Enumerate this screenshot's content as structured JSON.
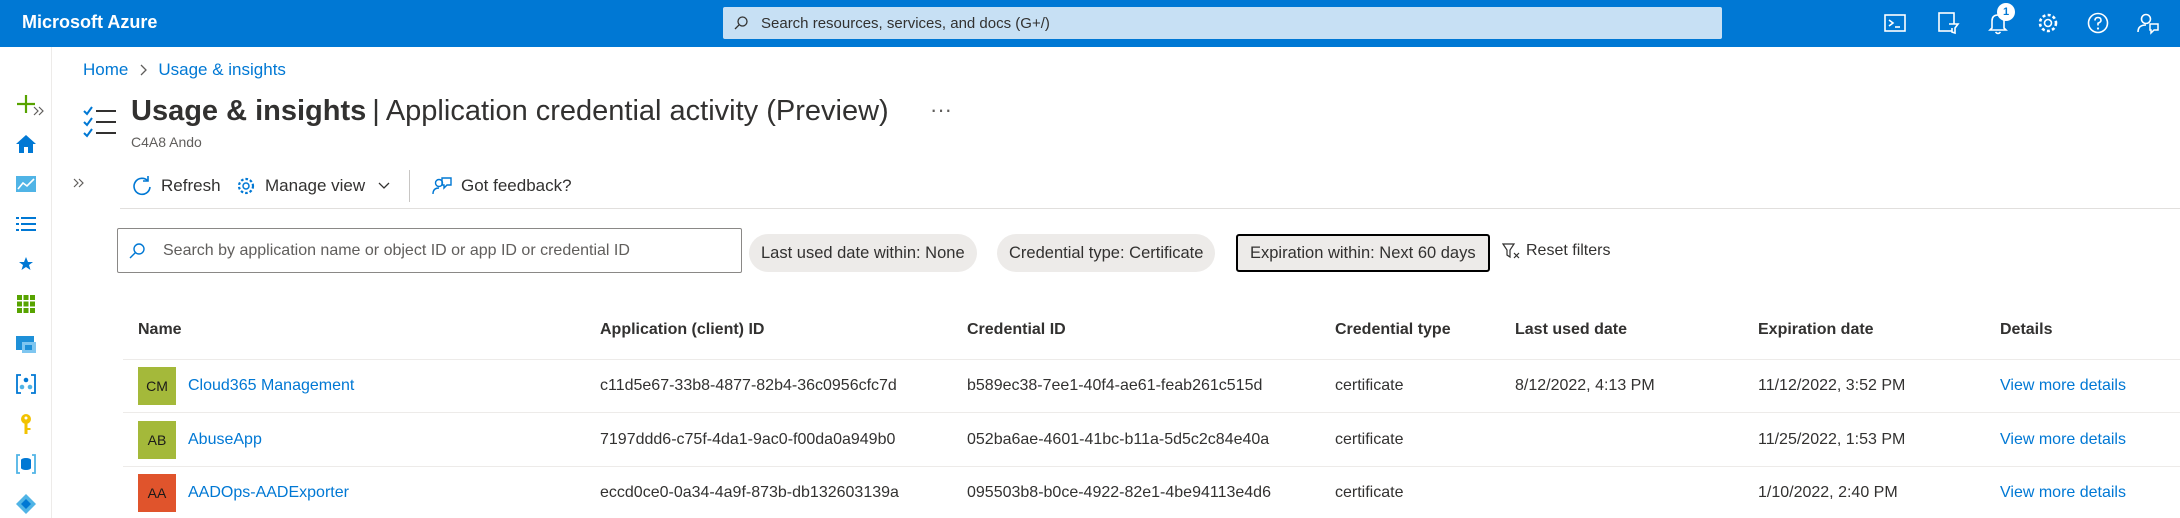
{
  "topbar": {
    "brand": "Microsoft Azure",
    "search_placeholder": "Search resources, services, and docs (G+/)",
    "notification_count": "1",
    "icons": [
      "cloud-shell-icon",
      "directory-filter-icon",
      "notifications-icon",
      "settings-icon",
      "help-icon",
      "feedback-icon"
    ]
  },
  "rail": {
    "icons": [
      "create-resource-icon",
      "home-icon",
      "dashboard-icon",
      "all-services-icon",
      "favorites-icon",
      "all-resources-icon",
      "resource-groups-icon",
      "app-services-icon",
      "key-vault-icon",
      "sql-icon",
      "azure-ad-icon"
    ]
  },
  "breadcrumb": {
    "home": "Home",
    "current": "Usage & insights"
  },
  "header": {
    "title_strong": "Usage & insights",
    "title_separator": "|",
    "title_rest": "Application credential activity (Preview)",
    "more": "···",
    "subtitle": "C4A8 Ando"
  },
  "commands": {
    "refresh": "Refresh",
    "manage_view": "Manage view",
    "feedback": "Got feedback?"
  },
  "filters": {
    "search_placeholder": "Search by application name or object ID or app ID or credential ID",
    "last_used": "Last used date within: None",
    "credential_type": "Credential type: Certificate",
    "expiration": "Expiration within: Next 60 days",
    "reset": "Reset filters"
  },
  "table": {
    "columns": [
      "Name",
      "Application (client) ID",
      "Credential ID",
      "Credential type",
      "Last used date",
      "Expiration date",
      "Details"
    ],
    "rows": [
      {
        "initials": "CM",
        "avatar_color": "#a4b93a",
        "name": "Cloud365 Management",
        "app_id": "c11d5e67-33b8-4877-82b4-36c0956cfc7d",
        "credential_id": "b589ec38-7ee1-40f4-ae61-feab261c515d",
        "type": "certificate",
        "last_used": "8/12/2022, 4:13 PM",
        "expiration": "11/12/2022, 3:52 PM",
        "details": "View more details"
      },
      {
        "initials": "AB",
        "avatar_color": "#a4b93a",
        "name": "AbuseApp",
        "app_id": "7197ddd6-c75f-4da1-9ac0-f00da0a949b0",
        "credential_id": "052ba6ae-4601-41bc-b11a-5d5c2c84e40a",
        "type": "certificate",
        "last_used": "",
        "expiration": "11/25/2022, 1:53 PM",
        "details": "View more details"
      },
      {
        "initials": "AA",
        "avatar_color": "#e0542c",
        "name": "AADOps-AADExporter",
        "app_id": "eccd0ce0-0a34-4a9f-873b-db132603139a",
        "credential_id": "095503b8-b0ce-4922-82e1-4be94113e4d6",
        "type": "certificate",
        "last_used": "",
        "expiration": "1/10/2022, 2:40 PM",
        "details": "View more details"
      }
    ]
  }
}
